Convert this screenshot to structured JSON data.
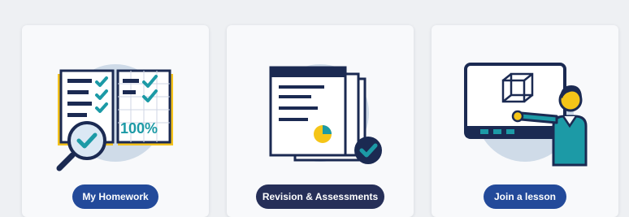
{
  "cards": [
    {
      "button_label": "My Homework",
      "icon": "open-book-checklist-magnifier-icon",
      "graphic_text": "100%"
    },
    {
      "button_label": "Revision & Assessments",
      "icon": "documents-pie-chart-check-icon"
    },
    {
      "button_label": "Join a lesson",
      "icon": "teacher-whiteboard-cube-icon"
    }
  ],
  "colors": {
    "circle": "#cfdbe8",
    "navy": "#1b2a52",
    "teal": "#1c9aa6",
    "yellow": "#f5c518",
    "button_blue": "#234a9a",
    "button_dark": "#262f58"
  }
}
